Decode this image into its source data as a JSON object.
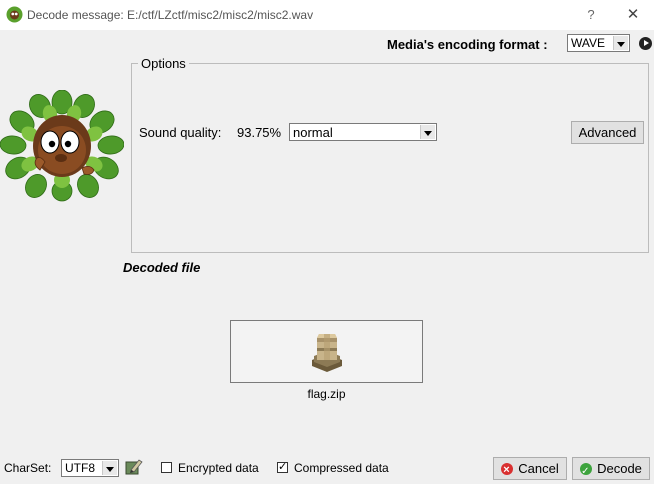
{
  "window": {
    "title": "Decode message: E:/ctf/LZctf/misc2/misc2/misc2.wav",
    "help_label": "?",
    "close_label": "✕"
  },
  "format": {
    "label": "Media's encoding format :",
    "value": "WAVE"
  },
  "options": {
    "legend": "Options",
    "quality_label": "Sound quality:",
    "quality_value": "93.75%",
    "quality_select": "normal",
    "advanced_label": "Advanced"
  },
  "decoded": {
    "title": "Decoded file",
    "file_name": "flag.zip"
  },
  "bottom": {
    "charset_label": "CharSet:",
    "charset_value": "UTF8",
    "encrypted_label": "Encrypted data",
    "encrypted_checked": false,
    "compressed_label": "Compressed data",
    "compressed_checked": true,
    "cancel_label": "Cancel",
    "decode_label": "Decode"
  },
  "icons": {
    "app": "leaf-mascot-icon",
    "play": "play-icon",
    "charset": "edit-charset-icon",
    "file": "package-icon",
    "cancel": "cancel-icon",
    "decode": "decode-check-icon"
  }
}
